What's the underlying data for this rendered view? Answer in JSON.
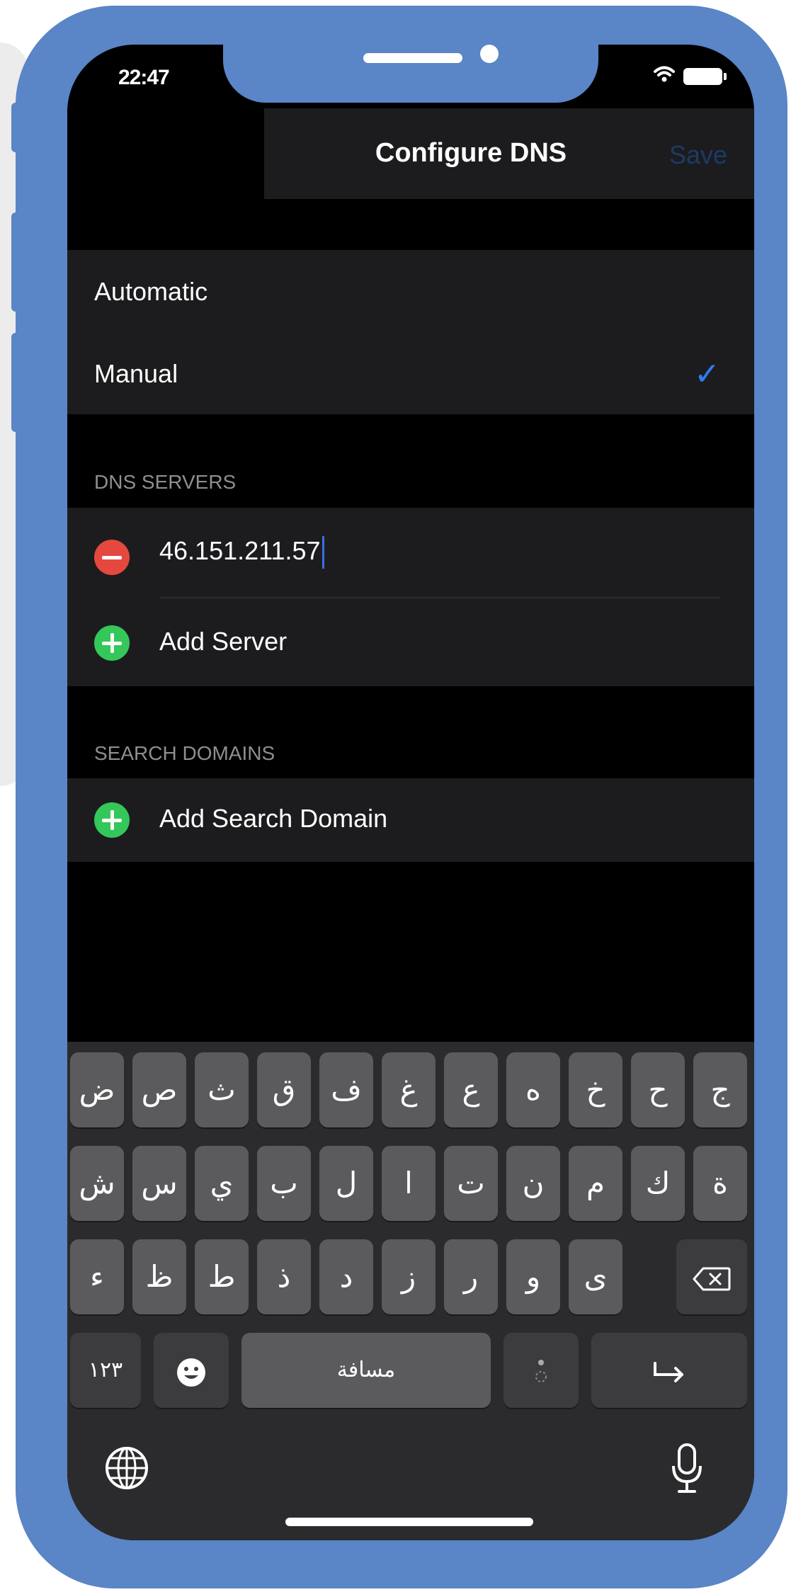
{
  "status_bar": {
    "time": "22:47"
  },
  "nav": {
    "title": "Configure DNS",
    "save_label": "Save"
  },
  "mode": {
    "automatic_label": "Automatic",
    "manual_label": "Manual",
    "selected": "Manual",
    "check_glyph": "✓"
  },
  "dns": {
    "header": "DNS SERVERS",
    "server_value": "46.151.211.57",
    "add_label": "Add Server"
  },
  "search": {
    "header": "SEARCH DOMAINS",
    "add_label": "Add Search Domain"
  },
  "keyboard": {
    "row1": [
      "ض",
      "ص",
      "ث",
      "ق",
      "ف",
      "غ",
      "ع",
      "ه",
      "خ",
      "ح",
      "ج"
    ],
    "row2": [
      "ش",
      "س",
      "ي",
      "ب",
      "ل",
      "ا",
      "ت",
      "ن",
      "م",
      "ك",
      "ة"
    ],
    "row3": [
      "ء",
      "ظ",
      "ط",
      "ذ",
      "د",
      "ز",
      "ر",
      "و",
      "ى"
    ],
    "numbers_label": "١٢٣",
    "space_label": "مسافة",
    "emoji_icon": "smiley-icon",
    "return_icon": "return-arrow-icon",
    "globe_icon": "globe-icon",
    "mic_icon": "microphone-icon",
    "delete_icon": "backspace-icon"
  },
  "colors": {
    "frame": "#5a85c6",
    "check": "#2f7cf6",
    "remove": "#e5483f",
    "add": "#34c759"
  }
}
